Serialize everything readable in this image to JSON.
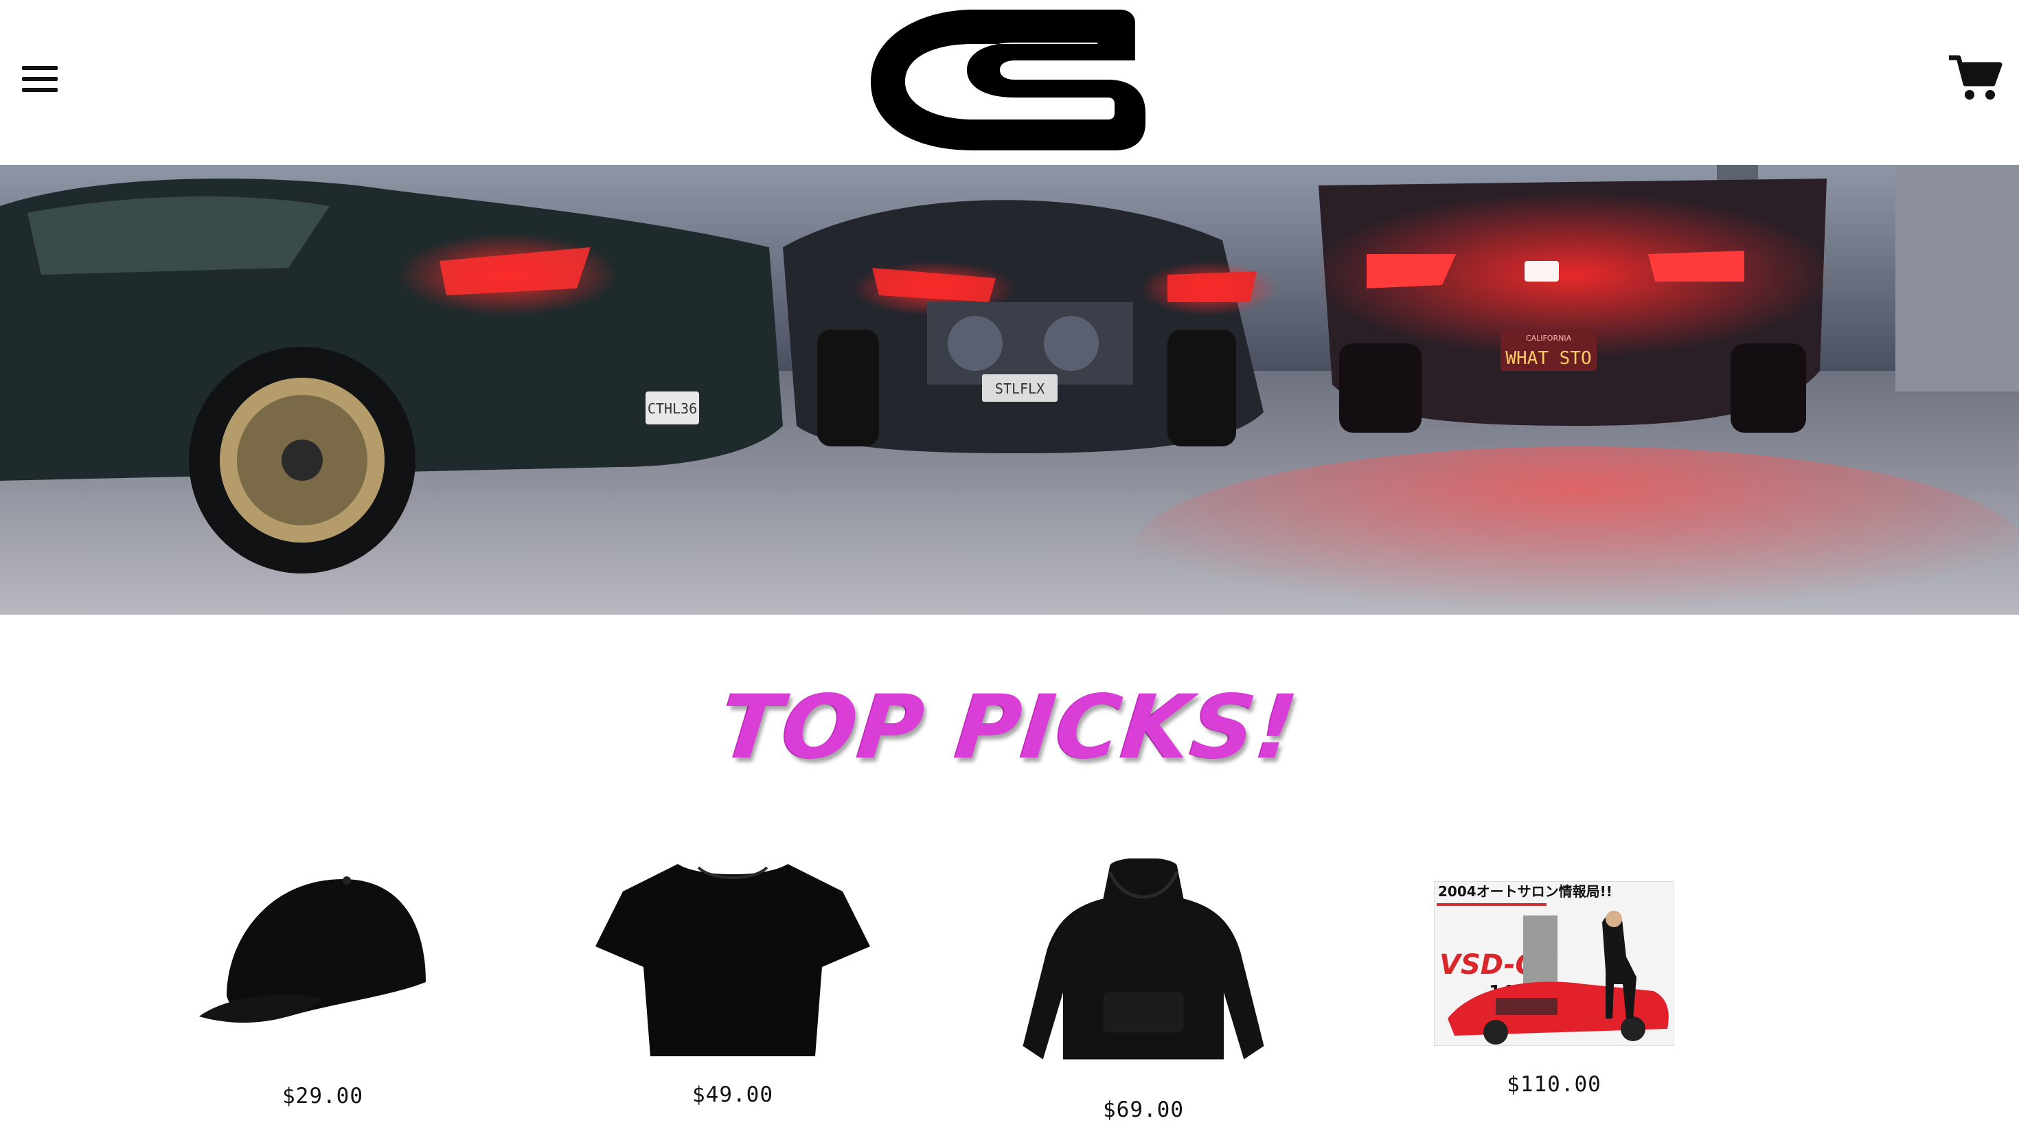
{
  "header": {
    "menu_icon": "hamburger-menu-icon",
    "logo_text": "CS",
    "cart_icon": "cart-icon"
  },
  "hero": {
    "plates": [
      "CTHL36",
      "STLFLX",
      "WHAT STO"
    ],
    "plate_state": "CALIFORNIA"
  },
  "top_picks": {
    "title": "TOP PICKS!"
  },
  "products": [
    {
      "name": "cap",
      "price": "$29.00"
    },
    {
      "name": "t-shirt",
      "price": "$49.00"
    },
    {
      "name": "hoodie",
      "price": "$69.00"
    },
    {
      "name": "magazine-print",
      "price": "$110.00",
      "headline": "2004オートサロン情報局!!",
      "subtitle": "VSD-GT",
      "number": "14"
    }
  ],
  "colors": {
    "title_pink": "#d93ed6",
    "text": "#111111",
    "background": "#ffffff"
  }
}
